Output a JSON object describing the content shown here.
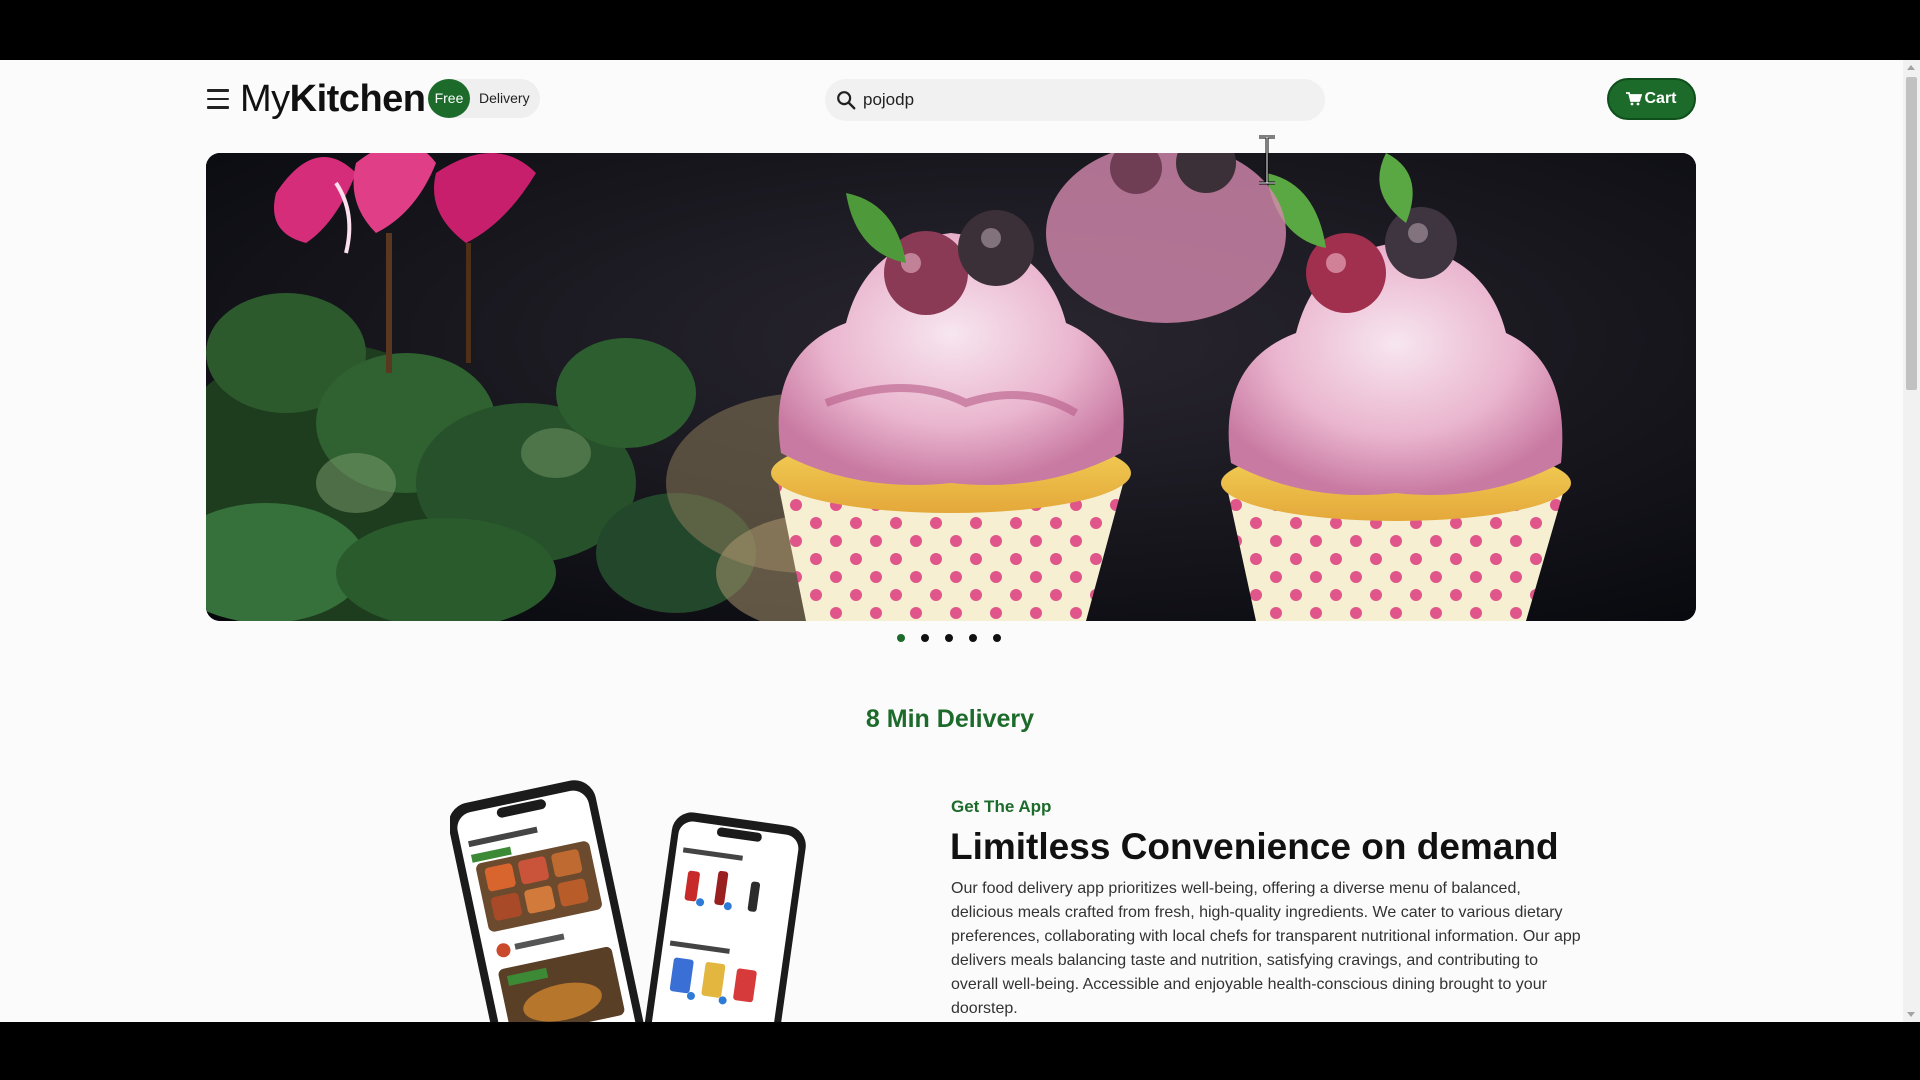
{
  "header": {
    "menu_icon": "hamburger-menu-icon",
    "logo_regular": "My",
    "logo_bold": "Kitchen",
    "free_badge": "Free",
    "free_text": "Delivery",
    "search": {
      "value": "pojodp",
      "icon": "search-icon"
    },
    "cart_label": "Cart",
    "cart_icon": "cart-icon"
  },
  "hero": {
    "image": "cupcakes-with-berries-photo",
    "dots_count": 5,
    "active_dot": 0
  },
  "section": {
    "title": "8 Min Delivery"
  },
  "promo": {
    "eyebrow": "Get The App",
    "headline": "Limitless Convenience on demand",
    "body": "Our food delivery app prioritizes well-being, offering a diverse menu of balanced, delicious meals crafted from fresh, high-quality ingredients. We cater to various dietary preferences, collaborating with local chefs for transparent nutritional information. Our app delivers meals balancing taste and nutrition, satisfying cravings, and contributing to overall well-being. Accessible and enjoyable health-conscious dining brought to your doorstep."
  },
  "colors": {
    "brand_green": "#1c6b2b",
    "page_bg": "#fbfbfb"
  }
}
